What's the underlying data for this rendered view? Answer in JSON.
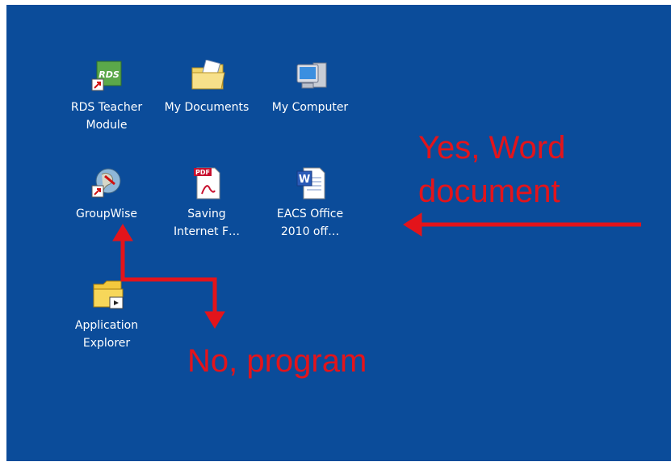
{
  "desktop": {
    "background_color": "#0b4c9a",
    "icons": [
      {
        "label": "RDS Teacher\nModule",
        "icon": "rds-icon",
        "badge_text": "RDS"
      },
      {
        "label": "My Documents",
        "icon": "folder-icon"
      },
      {
        "label": "My Computer",
        "icon": "computer-icon"
      },
      {
        "label": "GroupWise",
        "icon": "globe-icon"
      },
      {
        "label": "Saving\nInternet F…",
        "icon": "pdf-icon",
        "badge_text": "PDF"
      },
      {
        "label": "EACS Office\n2010 off…",
        "icon": "word-doc-icon",
        "badge_text": "W"
      },
      {
        "label": "Application\nExplorer",
        "icon": "folder-icon"
      }
    ]
  },
  "annotations": {
    "yes_text": "Yes, Word\ndocument",
    "no_text": "No, program",
    "color": "#e3141b"
  }
}
